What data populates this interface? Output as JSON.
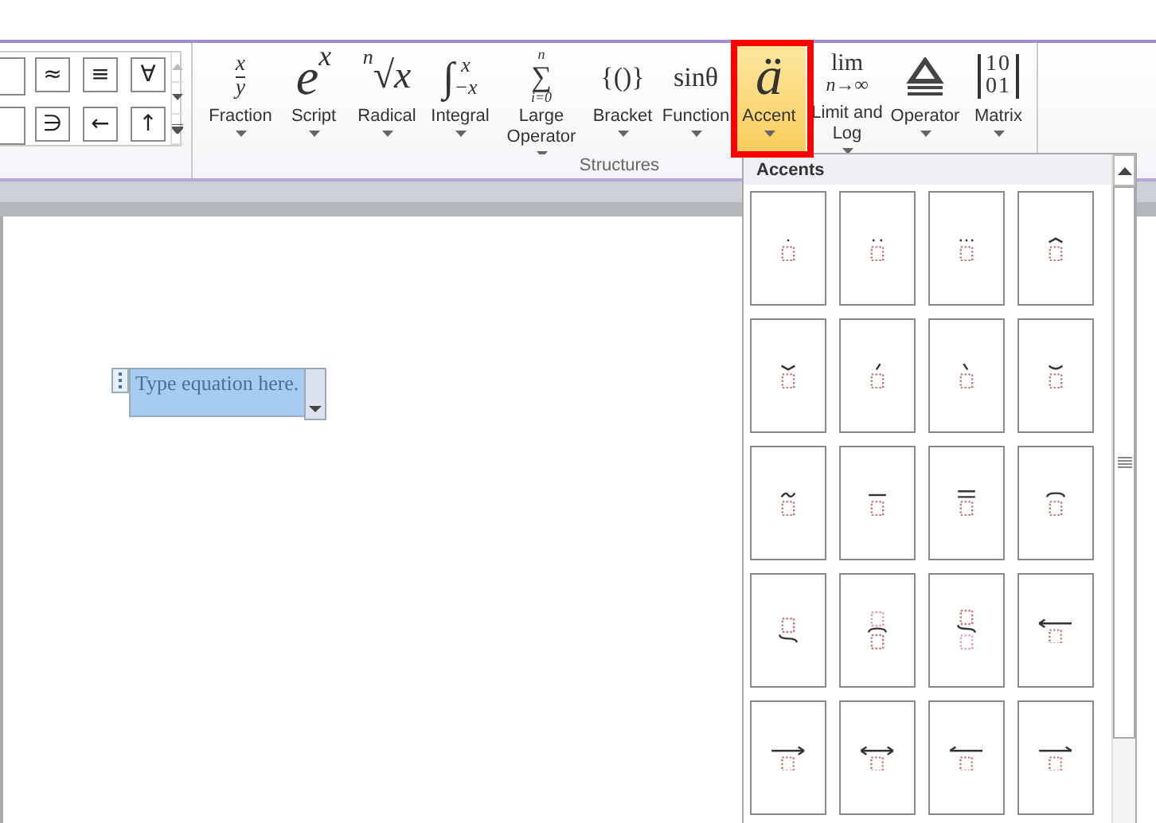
{
  "symbol_gallery": {
    "symbols": [
      "≈",
      "≡",
      "∀",
      "∋",
      "←",
      "↑"
    ]
  },
  "structures": {
    "label": "Structures",
    "tools": [
      {
        "kind": "fraction",
        "label": "Fraction",
        "glyphs": [
          "x",
          "y"
        ],
        "selected": false
      },
      {
        "kind": "script",
        "label": "Script",
        "glyphs": [
          "e",
          "x"
        ],
        "selected": false
      },
      {
        "kind": "radical",
        "label": "Radical",
        "glyphs": [
          "n",
          "√",
          "x"
        ],
        "selected": false
      },
      {
        "kind": "integral",
        "label": "Integral",
        "glyphs": [
          "∫",
          "x",
          "−x"
        ],
        "selected": false
      },
      {
        "kind": "large",
        "label": "Large Operator",
        "glyphs": [
          "n",
          "∑",
          "i=0"
        ],
        "selected": false
      },
      {
        "kind": "plain",
        "label": "Bracket",
        "glyphs": [
          "{()}"
        ],
        "selected": false
      },
      {
        "kind": "plain",
        "label": "Function",
        "glyphs": [
          "sinθ"
        ],
        "selected": false
      },
      {
        "kind": "accent",
        "label": "Accent",
        "glyphs": [
          "ä"
        ],
        "selected": true
      },
      {
        "kind": "limit",
        "label": "Limit and Log",
        "glyphs": [
          "lim",
          "n→∞"
        ],
        "selected": false
      },
      {
        "kind": "operator",
        "label": "Operator",
        "selected": false
      },
      {
        "kind": "matrix",
        "label": "Matrix",
        "glyphs": [
          "10",
          "01"
        ],
        "selected": false
      }
    ]
  },
  "accents_menu": {
    "title": "Accents",
    "tiles": [
      {
        "kind": "dot"
      },
      {
        "kind": "ddot"
      },
      {
        "kind": "dddot"
      },
      {
        "kind": "hat"
      },
      {
        "kind": "check"
      },
      {
        "kind": "acute"
      },
      {
        "kind": "grave"
      },
      {
        "kind": "breve"
      },
      {
        "kind": "tilde"
      },
      {
        "kind": "bar"
      },
      {
        "kind": "doublebar"
      },
      {
        "kind": "overbrace"
      },
      {
        "kind": "underbrace"
      },
      {
        "kind": "overbrace-group"
      },
      {
        "kind": "underbrace-group"
      },
      {
        "kind": "left-arrow"
      },
      {
        "kind": "right-arrow"
      },
      {
        "kind": "both-arrow"
      },
      {
        "kind": "left-harpoon"
      },
      {
        "kind": "right-harpoon"
      }
    ]
  },
  "equation": {
    "placeholder": "Type equation here."
  }
}
